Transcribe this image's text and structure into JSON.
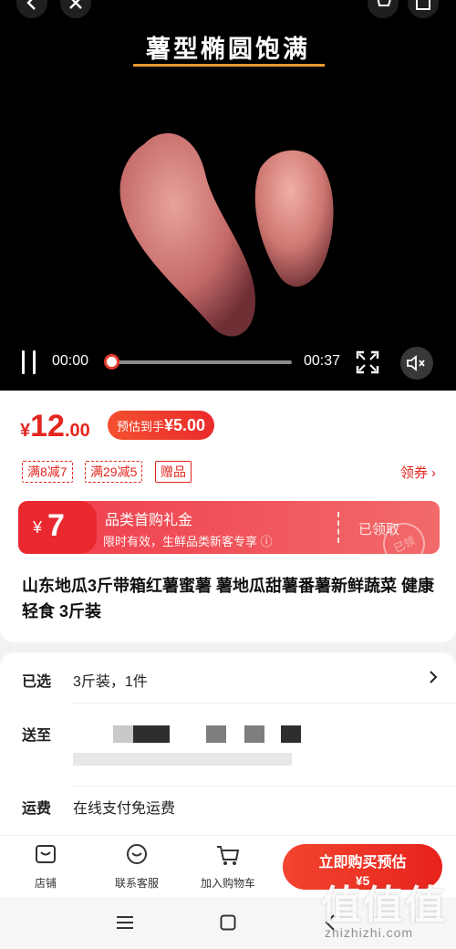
{
  "video": {
    "caption": "薯型椭圆饱满",
    "current_time": "00:00",
    "duration": "00:37",
    "progress": 0.0
  },
  "price": {
    "currency": "¥",
    "integer": "12",
    "decimal": ".00",
    "estimate_label": "预估到手",
    "estimate_value": "¥5.00"
  },
  "tags": [
    "满8减7",
    "满29减5",
    "赠品"
  ],
  "coupon_link": "领券 ›",
  "coupon_banner": {
    "currency": "¥",
    "amount": "7",
    "title": "品类首购礼金",
    "subtitle": "限时有效，生鲜品类新客专享 ⓘ",
    "status": "已领取",
    "stamp": "已领"
  },
  "product_title": "山东地瓜3斤带箱红薯蜜薯 薯地瓜甜薯番薯新鲜蔬菜 健康轻食 3斤装",
  "spec": {
    "selected_label": "已选",
    "selected_value": "3斤装，1件",
    "ship_label": "送至",
    "freight_label": "运费",
    "freight_value": "在线支付免运费"
  },
  "bottom_bar": {
    "shop": "店铺",
    "service": "联系客服",
    "cart": "加入购物车",
    "buy_line1": "立即购买预估",
    "buy_line2": "¥5"
  },
  "watermark": {
    "glyphs": "值值值",
    "url": "zhizhizhi.com"
  },
  "colors": {
    "accent": "#e4261f",
    "banner": "#ef3c4a",
    "video_bg": "#000000",
    "progress_knob_border": "#e23b2e"
  }
}
